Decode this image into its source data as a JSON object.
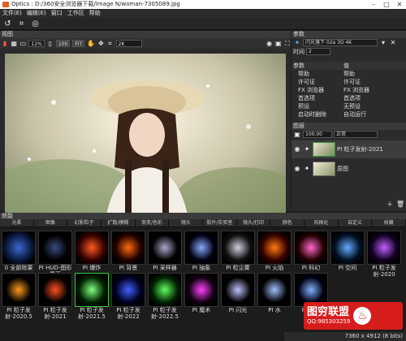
{
  "titlebar": {
    "title": "Optics : D:/360安全浏览器下载/Image N/woman-7305089.jpg",
    "min": "–",
    "max": "□",
    "close": "✕"
  },
  "menu": [
    "文件(E)",
    "编辑(E)",
    "窗口",
    "工作区",
    "帮助"
  ],
  "viewer": {
    "title": "视图",
    "zoom": "12%",
    "btn100": "100",
    "btnfit": "FIT",
    "resolution": "2K"
  },
  "params_panel": {
    "title": "参数",
    "preset": "闪光落下 02a 3D 4K",
    "time_label": "时间",
    "time_value": "2",
    "col_params": "参数",
    "col_value": "值",
    "rows": [
      [
        "帮助",
        "帮助"
      ],
      [
        "许可证",
        "许可证"
      ],
      [
        "FX 浏览器",
        "FX 浏览器"
      ],
      [
        "首选项",
        "首选项"
      ],
      [
        "预设",
        "无预设"
      ],
      [
        "启动时删除",
        "自动运行"
      ]
    ]
  },
  "layers": {
    "title": "图层",
    "opacity": "100.00",
    "blend": "正常",
    "items": [
      {
        "name": "PI 粒子发射-2021"
      },
      {
        "name": "原图"
      }
    ]
  },
  "effects": {
    "title": "效能",
    "tabs": [
      "光柔",
      "图像",
      "幻影粒子",
      "扩散/模糊",
      "渐变/色彩",
      "镜头",
      "胶片/实验室",
      "镜头/打印",
      "颜色",
      "风格化",
      "自定义",
      "收藏"
    ],
    "row1": [
      "0 全部效果",
      "PI HUD-图形界面",
      "PI 爆炸",
      "PI 背景",
      "PI 采样器",
      "PI 抽象",
      "PI 粒尘雾",
      "PI 火焰",
      "PI 科幻",
      "PI 空间",
      "PI 粒子发射-2020"
    ],
    "row2": [
      "PI 粒子发射-2020.5",
      "PI 粒子发射-2021",
      "PI 粒子发射-2021.5",
      "PI 粒子发射-2022",
      "PI 粒子发射-2022.5",
      "PI 魔术",
      "PI 闪光",
      "PI 水",
      "PI 星星",
      "",
      ""
    ]
  },
  "status": {
    "dimensions": "7360 x 4912 (8 bits)"
  },
  "watermark": {
    "brand": "图穷联盟",
    "qq": "QQ:985303259"
  },
  "colors": {
    "accent": "#1f7fd0",
    "selected": "#3a78c0",
    "watermark_red": "#d71c1c"
  }
}
